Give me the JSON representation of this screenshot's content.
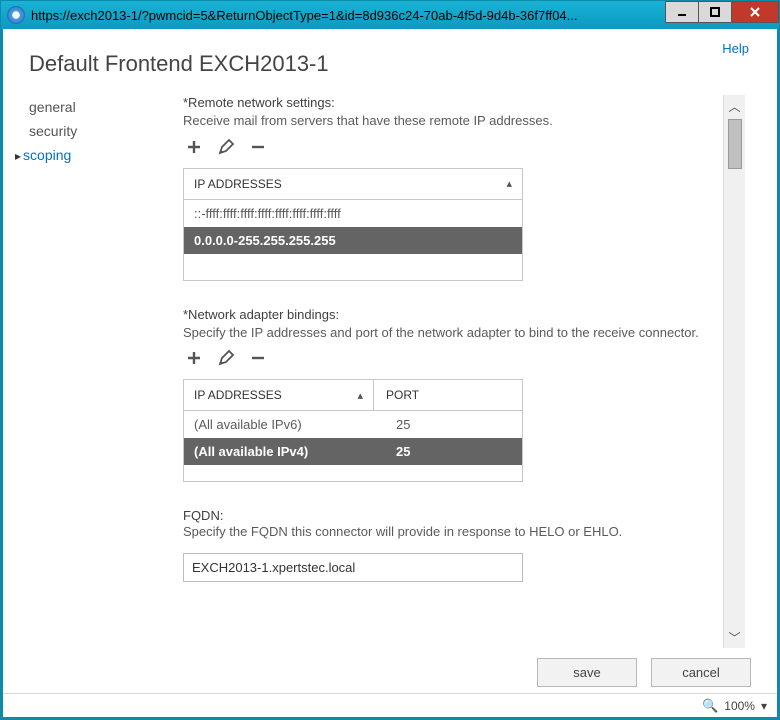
{
  "window": {
    "url": "https://exch2013-1/?pwmcid=5&ReturnObjectType=1&id=8d936c24-70ab-4f5d-9d4b-36f7ff04...",
    "help_label": "Help"
  },
  "page_title": "Default Frontend EXCH2013-1",
  "sidenav": {
    "items": [
      {
        "label": "general",
        "active": false
      },
      {
        "label": "security",
        "active": false
      },
      {
        "label": "scoping",
        "active": true
      }
    ]
  },
  "remote": {
    "label": "*Remote network settings:",
    "desc": "Receive mail from servers that have these remote IP addresses.",
    "header": "IP ADDRESSES",
    "rows": [
      {
        "ip": "::-ffff:ffff:ffff:ffff:ffff:ffff:ffff:ffff",
        "selected": false
      },
      {
        "ip": "0.0.0.0-255.255.255.255",
        "selected": true
      }
    ]
  },
  "bindings": {
    "label": "*Network adapter bindings:",
    "desc": "Specify the IP addresses and port of the network adapter to bind to the receive connector.",
    "header_ip": "IP ADDRESSES",
    "header_port": "PORT",
    "rows": [
      {
        "ip": "(All available IPv6)",
        "port": "25",
        "selected": false
      },
      {
        "ip": "(All available IPv4)",
        "port": "25",
        "selected": true
      }
    ]
  },
  "fqdn": {
    "label": "FQDN:",
    "desc": "Specify the FQDN this connector will provide in response to HELO or EHLO.",
    "value": "EXCH2013-1.xpertstec.local"
  },
  "footer": {
    "save": "save",
    "cancel": "cancel"
  },
  "statusbar": {
    "zoom": "100%"
  }
}
